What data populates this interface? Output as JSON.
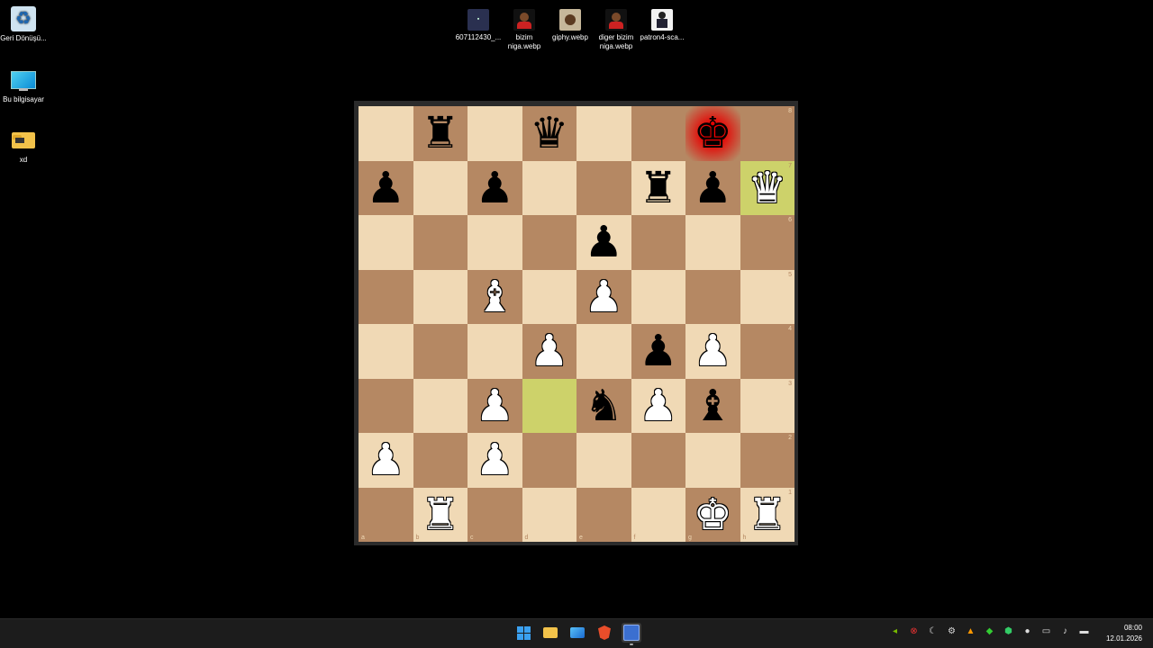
{
  "desktop_left": [
    {
      "label": "Geri Dönüşü...",
      "icon": "recycle-bin-icon"
    },
    {
      "label": "Bu bilgisayar",
      "icon": "computer-icon"
    },
    {
      "label": "xd",
      "icon": "folder-icon"
    }
  ],
  "desktop_top": [
    {
      "label": "607112430_...",
      "icon": "image-file-icon"
    },
    {
      "label": "bizim niga.webp",
      "icon": "image-file-icon"
    },
    {
      "label": "giphy.webp",
      "icon": "image-file-icon"
    },
    {
      "label": "diger bizim niga.webp",
      "icon": "image-file-icon"
    },
    {
      "label": "patron4-sca...",
      "icon": "image-file-icon"
    }
  ],
  "board": {
    "ranks": [
      "8",
      "7",
      "6",
      "5",
      "4",
      "3",
      "2",
      "1"
    ],
    "files": [
      "a",
      "b",
      "c",
      "d",
      "e",
      "f",
      "g",
      "h"
    ],
    "position": [
      [
        "",
        "bR",
        "",
        "bQ",
        "",
        "",
        "bK",
        ""
      ],
      [
        "bP",
        "",
        "bP",
        "",
        "",
        "bR",
        "bP",
        "wQ"
      ],
      [
        "",
        "",
        "",
        "",
        "bP",
        "",
        "",
        ""
      ],
      [
        "",
        "",
        "wB",
        "",
        "wP",
        "",
        "",
        ""
      ],
      [
        "",
        "",
        "",
        "wP",
        "",
        "bP",
        "wP",
        ""
      ],
      [
        "",
        "",
        "wP",
        "",
        "bN",
        "wP",
        "bB",
        ""
      ],
      [
        "wP",
        "",
        "wP",
        "",
        "",
        "",
        "",
        ""
      ],
      [
        "",
        "wR",
        "",
        "",
        "",
        "",
        "wK",
        "wR"
      ]
    ],
    "highlight_squares": [
      "h7",
      "d3"
    ],
    "check_square": "g8",
    "colors": {
      "light": "#f0d9b5",
      "dark": "#b58863",
      "highlight": "#cdd26a",
      "check": "#ff0000"
    }
  },
  "taskbar": {
    "apps": [
      {
        "name": "start-button",
        "icon": "windows-icon"
      },
      {
        "name": "file-explorer-button",
        "icon": "folder-icon"
      },
      {
        "name": "photos-button",
        "icon": "photos-icon"
      },
      {
        "name": "brave-browser-button",
        "icon": "brave-icon"
      },
      {
        "name": "active-app-button",
        "icon": "app-icon"
      }
    ],
    "clock_time": "08:00",
    "clock_date": "12.01.2026"
  }
}
